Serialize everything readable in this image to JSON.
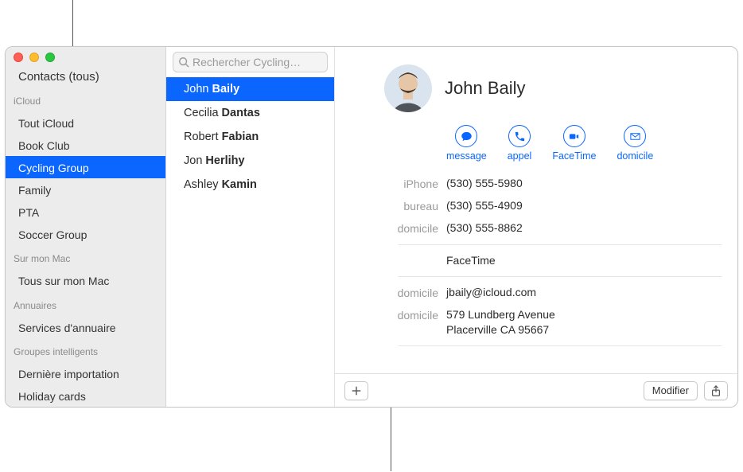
{
  "sidebar": {
    "all_contacts": "Contacts (tous)",
    "sections": [
      {
        "heading": "iCloud",
        "items": [
          "Tout iCloud",
          "Book Club",
          "Cycling Group",
          "Family",
          "PTA",
          "Soccer Group"
        ],
        "selected_index": 2
      },
      {
        "heading": "Sur mon Mac",
        "items": [
          "Tous sur mon Mac"
        ]
      },
      {
        "heading": "Annuaires",
        "items": [
          "Services d'annuaire"
        ]
      },
      {
        "heading": "Groupes intelligents",
        "items": [
          "Dernière importation",
          "Holiday cards"
        ]
      }
    ]
  },
  "search": {
    "placeholder": "Rechercher Cycling…"
  },
  "contacts": [
    {
      "first": "John",
      "last": "Baily"
    },
    {
      "first": "Cecilia",
      "last": "Dantas"
    },
    {
      "first": "Robert",
      "last": "Fabian"
    },
    {
      "first": "Jon",
      "last": "Herlihy"
    },
    {
      "first": "Ashley",
      "last": "Kamin"
    }
  ],
  "contacts_selected_index": 0,
  "detail": {
    "name": "John Baily",
    "actions": {
      "message": "message",
      "call": "appel",
      "facetime": "FaceTime",
      "home": "domicile"
    },
    "phones": [
      {
        "label": "iPhone",
        "value": "(530) 555-5980"
      },
      {
        "label": "bureau",
        "value": "(530) 555-4909"
      },
      {
        "label": "domicile",
        "value": "(530) 555-8862"
      }
    ],
    "facetime_label": "FaceTime",
    "email": {
      "label": "domicile",
      "value": "jbaily@icloud.com"
    },
    "address": {
      "label": "domicile",
      "line1": "579 Lundberg Avenue",
      "line2": "Placerville CA 95667"
    }
  },
  "buttons": {
    "modify": "Modifier"
  }
}
